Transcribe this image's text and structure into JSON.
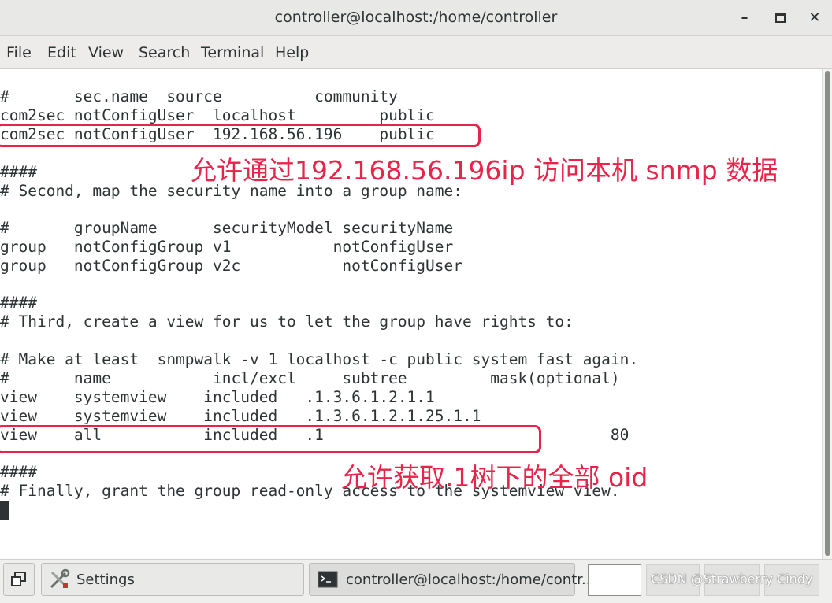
{
  "window": {
    "title": "controller@localhost:/home/controller",
    "minimize_icon": "minimize-icon",
    "maximize_icon": "maximize-icon",
    "close_icon": "close-icon"
  },
  "menu": [
    "File",
    "Edit",
    "View",
    "Search",
    "Terminal",
    "Help"
  ],
  "terminal_lines": [
    "#       sec.name  source          community",
    "com2sec notConfigUser  localhost         public",
    "com2sec notConfigUser  192.168.56.196    public",
    "",
    "####",
    "# Second, map the security name into a group name:",
    "",
    "#       groupName      securityModel securityName",
    "group   notConfigGroup v1           notConfigUser",
    "group   notConfigGroup v2c           notConfigUser",
    "",
    "####",
    "# Third, create a view for us to let the group have rights to:",
    "",
    "# Make at least  snmpwalk -v 1 localhost -c public system fast again.",
    "#       name           incl/excl     subtree         mask(optional)",
    "view    systemview    included   .1.3.6.1.2.1.1",
    "view    systemview    included   .1.3.6.1.2.1.25.1.1",
    "view    all           included   .1                               80",
    "",
    "####",
    "# Finally, grant the group read-only access to the systemview view."
  ],
  "annotations": {
    "note1": "允许通过192.168.56.196ip 访问本机 snmp 数据",
    "note2": "允许获取.1树下的全部 oid"
  },
  "annotation_color": "#e9244a",
  "taskbar": {
    "settings_label": "Settings",
    "terminal_label": "controller@localhost:/home/contr...",
    "show_desktop_icon": "show-desktop-icon",
    "settings_icon": "tools-icon",
    "terminal_icon": "terminal-icon"
  },
  "watermark": "CSDN @Strawberry Cindy"
}
